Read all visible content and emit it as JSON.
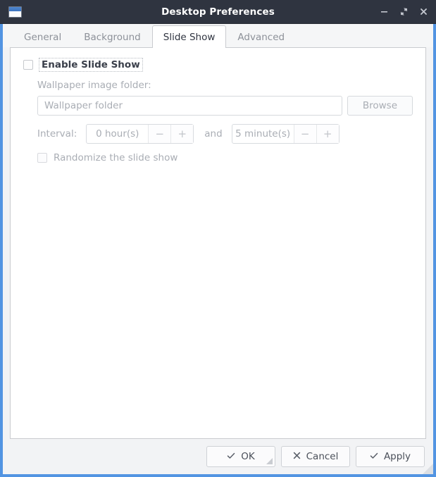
{
  "window": {
    "title": "Desktop Preferences",
    "icon": "window-icon",
    "controls": [
      {
        "name": "minimize-button",
        "glyph": "minimize-icon"
      },
      {
        "name": "maximize-button",
        "glyph": "maximize-icon"
      },
      {
        "name": "close-button",
        "glyph": "close-icon"
      }
    ],
    "accent_border": "#5294e2",
    "titlebar_bg": "#2f3440"
  },
  "tabs": [
    {
      "label": "General",
      "active": false
    },
    {
      "label": "Background",
      "active": false
    },
    {
      "label": "Slide Show",
      "active": true
    },
    {
      "label": "Advanced",
      "active": false
    }
  ],
  "slideshow": {
    "enable": {
      "label": "Enable Slide Show",
      "checked": false
    },
    "folder": {
      "label": "Wallpaper image folder:",
      "value": "",
      "placeholder": "Wallpaper folder",
      "browse_label": "Browse"
    },
    "interval": {
      "label": "Interval:",
      "hours_value": "0 hour(s)",
      "conjunction": "and",
      "minutes_value": "5 minute(s)",
      "decrement": "−",
      "increment": "+"
    },
    "randomize": {
      "label": "Randomize the slide show",
      "checked": false
    }
  },
  "actions": {
    "ok": {
      "label": "OK",
      "icon": "check-icon"
    },
    "cancel": {
      "label": "Cancel",
      "icon": "cross-icon"
    },
    "apply": {
      "label": "Apply",
      "icon": "check-icon"
    }
  }
}
